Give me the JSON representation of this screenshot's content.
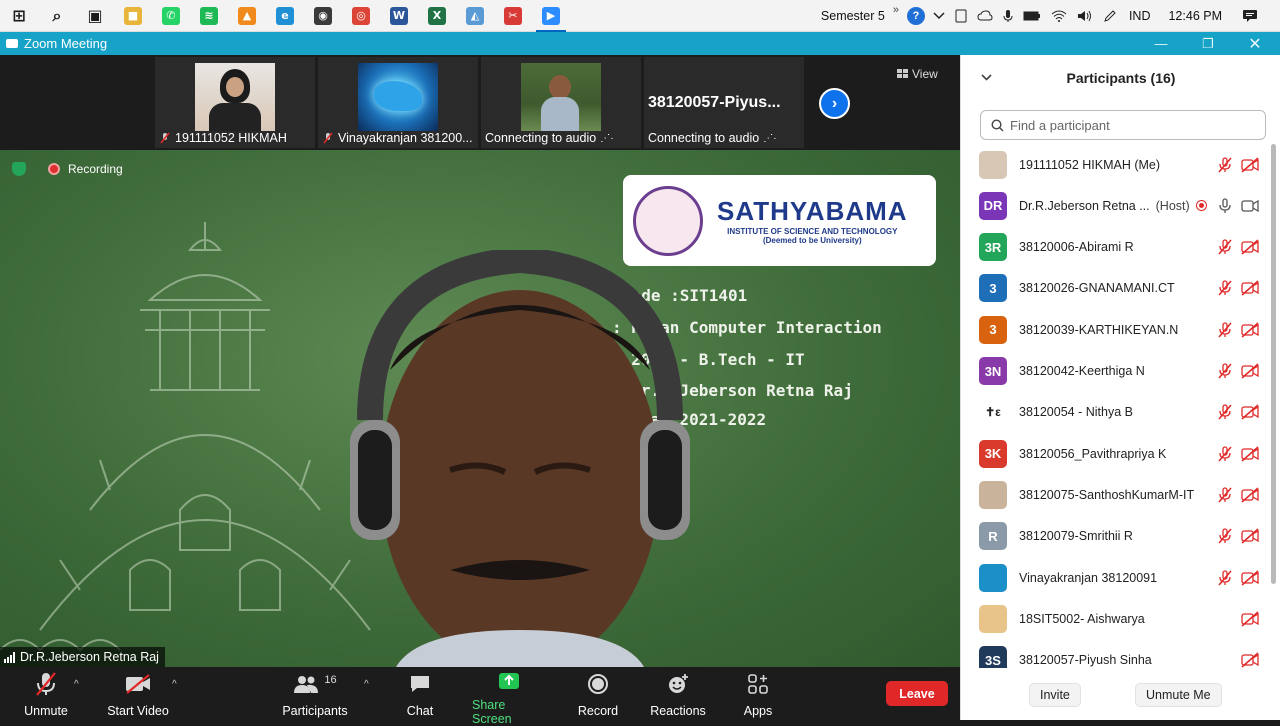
{
  "taskbar": {
    "apps": [
      {
        "name": "start",
        "color": "#1a1a1a",
        "glyph": "⊞"
      },
      {
        "name": "search",
        "color": "#1a1a1a",
        "glyph": "⌕"
      },
      {
        "name": "task-view",
        "color": "#1a1a1a",
        "glyph": "▣"
      },
      {
        "name": "file-explorer",
        "color": "#e8b53a",
        "glyph": "■"
      },
      {
        "name": "whatsapp",
        "color": "#25d366",
        "glyph": "✆"
      },
      {
        "name": "spotify",
        "color": "#1db954",
        "glyph": "≋"
      },
      {
        "name": "vlc",
        "color": "#f08a1c",
        "glyph": "▲"
      },
      {
        "name": "edge",
        "color": "#1f8fd6",
        "glyph": "e"
      },
      {
        "name": "obs",
        "color": "#3a3a3a",
        "glyph": "◉"
      },
      {
        "name": "chrome",
        "color": "#db4437",
        "glyph": "◎"
      },
      {
        "name": "word",
        "color": "#2b579a",
        "glyph": "W"
      },
      {
        "name": "excel",
        "color": "#217346",
        "glyph": "X"
      },
      {
        "name": "photos",
        "color": "#5b9bd5",
        "glyph": "◭"
      },
      {
        "name": "snip",
        "color": "#d83b36",
        "glyph": "✂"
      },
      {
        "name": "zoom",
        "color": "#2d8cff",
        "glyph": "▶"
      }
    ],
    "semester": "Semester 5",
    "language": "IND",
    "time": "12:46 PM"
  },
  "window": {
    "title": "Zoom Meeting"
  },
  "thumbnails": [
    {
      "label": "191111052 HIKMAH",
      "muted": true,
      "pic": "#d9c7b6"
    },
    {
      "label": "Vinayakranjan 381200...",
      "muted": true,
      "pic": "#1b6fb8"
    },
    {
      "label": "Connecting to audio",
      "muted": false,
      "pic": "#3e5a2e"
    },
    {
      "label": "Connecting to audio",
      "muted": false,
      "pic": ""
    }
  ],
  "thumbnail_bigname": "38120057-Piyus...",
  "view_label": "View",
  "recording_label": "Recording",
  "slide": {
    "logo_title": "SATHYABAMA",
    "logo_sub1": "INSTITUTE OF SCIENCE AND TECHNOLOGY",
    "logo_sub2": "(Deemed to be University)",
    "lines": [
      "Code   :SIT1401",
      "       : Human Computer Interaction",
      "       : 2018 - B.Tech - IT",
      "       : Dr.R.Jeberson Retna Raj",
      "       c Year 2021-2022"
    ]
  },
  "active_speaker": "Dr.R.Jeberson Retna Raj",
  "toolbar": {
    "unmute": "Unmute",
    "start_video": "Start Video",
    "participants": "Participants",
    "participants_count": "16",
    "chat": "Chat",
    "share_screen": "Share Screen",
    "record": "Record",
    "reactions": "Reactions",
    "apps": "Apps",
    "leave": "Leave"
  },
  "panel": {
    "title": "Participants (16)",
    "search_placeholder": "Find a participant",
    "invite": "Invite",
    "unmute_me": "Unmute Me",
    "participants": [
      {
        "name": "191111052 HIKMAH (Me)",
        "avatar": "",
        "color": "#d9c7b6",
        "mic": "muted",
        "cam": "off"
      },
      {
        "name": "Dr.R.Jeberson Retna ...",
        "role": "(Host)",
        "avatar": "DR",
        "color": "#7b36b8",
        "mic": "on",
        "cam": "on"
      },
      {
        "name": "38120006-Abirami R",
        "avatar": "3R",
        "color": "#23a55a",
        "mic": "muted",
        "cam": "off"
      },
      {
        "name": "38120026-GNANAMANI.CT",
        "avatar": "3",
        "color": "#1f6fb8",
        "mic": "muted",
        "cam": "off"
      },
      {
        "name": "38120039-KARTHIKEYAN.N",
        "avatar": "3",
        "color": "#d9620e",
        "mic": "muted",
        "cam": "off"
      },
      {
        "name": "38120042-Keerthiga N",
        "avatar": "3N",
        "color": "#8a3aa8",
        "mic": "muted",
        "cam": "off"
      },
      {
        "name": "38120054 - Nithya B",
        "avatar": "✝ε",
        "color": "#ffffff",
        "mic": "muted",
        "cam": "off"
      },
      {
        "name": "38120056_Pavithrapriya K",
        "avatar": "3K",
        "color": "#d93a2b",
        "mic": "muted",
        "cam": "off"
      },
      {
        "name": "38120075-SanthoshKumarM-IT",
        "avatar": "",
        "color": "#c9b39a",
        "mic": "muted",
        "cam": "off"
      },
      {
        "name": "38120079-Smrithii R",
        "avatar": "R",
        "color": "#8a9aa8",
        "mic": "muted",
        "cam": "off"
      },
      {
        "name": "Vinayakranjan 38120091",
        "avatar": "",
        "color": "#1b8fc8",
        "mic": "muted",
        "cam": "off"
      },
      {
        "name": "18SIT5002- Aishwarya",
        "avatar": "",
        "color": "#e8c48a",
        "mic": "none",
        "cam": "off"
      },
      {
        "name": "38120057-Piyush Sinha",
        "avatar": "3S",
        "color": "#1f3a5a",
        "mic": "none",
        "cam": "off"
      }
    ]
  }
}
